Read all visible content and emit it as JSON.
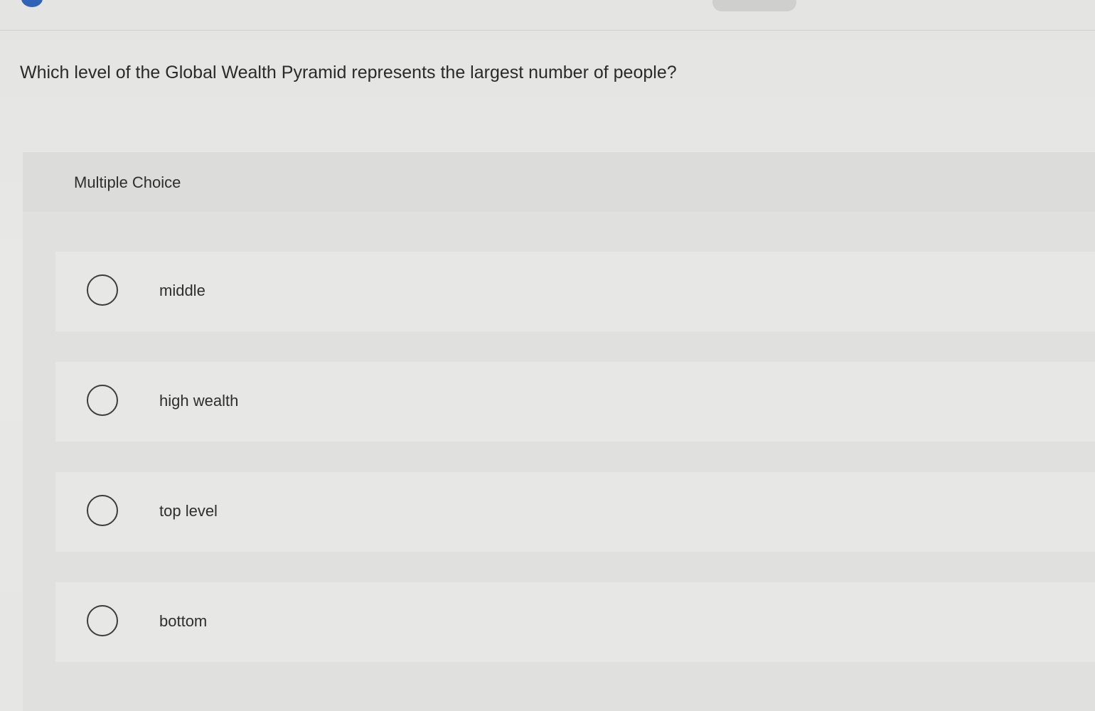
{
  "question": {
    "text": "Which level of the Global Wealth Pyramid represents the largest number of people?"
  },
  "multiple_choice": {
    "label": "Multiple Choice",
    "options": [
      {
        "label": "middle",
        "selected": false
      },
      {
        "label": "high wealth",
        "selected": false
      },
      {
        "label": "top level",
        "selected": false
      },
      {
        "label": "bottom",
        "selected": false
      }
    ]
  },
  "colors": {
    "background": "#e6e6e4",
    "text": "#2a2a2a",
    "accent": "#2f63b8"
  }
}
